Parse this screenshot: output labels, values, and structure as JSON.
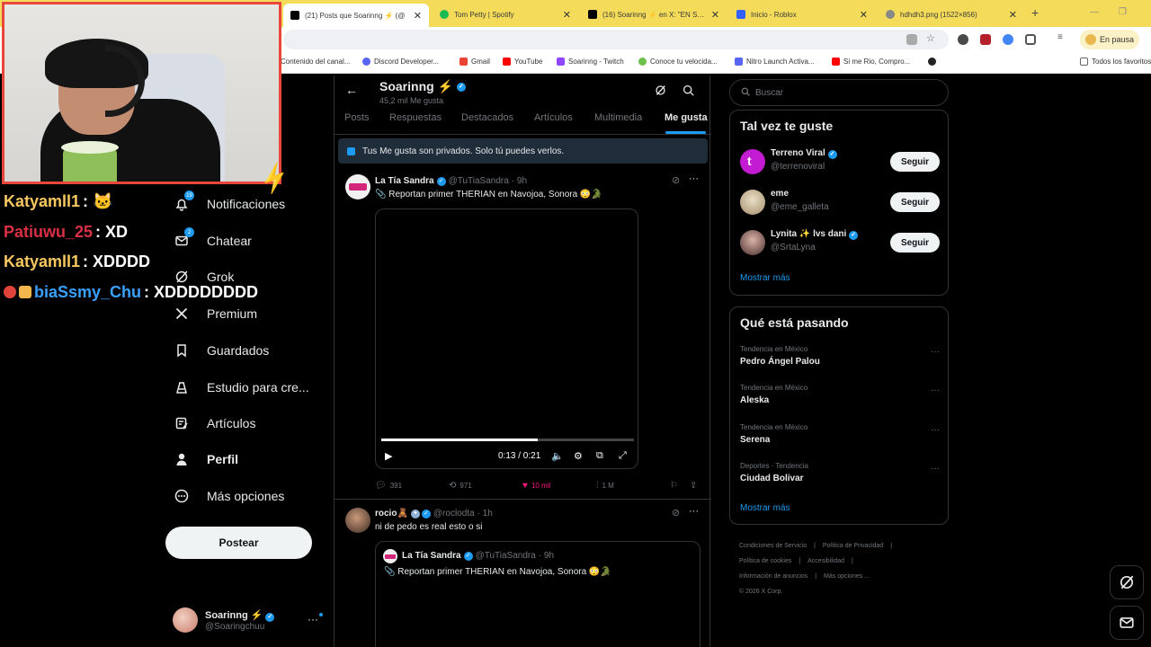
{
  "browser": {
    "tabs": [
      {
        "label": "(21) Posts que Soarinng ⚡ (@",
        "icon": "x-logo",
        "active": true
      },
      {
        "label": "Tom Petty | Spotify",
        "icon": "spotify-logo",
        "active": false
      },
      {
        "label": "(16) Soarinng ⚡ en X: \"EN STR",
        "icon": "x-logo",
        "active": false
      },
      {
        "label": "Inicio - Roblox",
        "icon": "roblox-logo",
        "active": false
      },
      {
        "label": "hdhdh3.png (1522×856)",
        "icon": "image-icon",
        "active": false
      }
    ],
    "paused_label": "En pausa",
    "bookmarks": [
      "Contenido del canal...",
      "Discord Developer...",
      "Gmail",
      "YouTube",
      "Soarinng - Twitch",
      "Conoce tu velocida...",
      "Nitro Launch Activa...",
      "Si me Rio, Compro..."
    ],
    "all_bookmarks": "Todos los favoritos"
  },
  "nav": {
    "items": [
      {
        "label": "Notificaciones",
        "icon": "bell-icon",
        "badge": "19"
      },
      {
        "label": "Chatear",
        "icon": "envelope-icon",
        "badge": "2"
      },
      {
        "label": "Grok",
        "icon": "grok-icon"
      },
      {
        "label": "Premium",
        "icon": "x-icon"
      },
      {
        "label": "Guardados",
        "icon": "bookmark-icon"
      },
      {
        "label": "Estudio para cre...",
        "icon": "creator-icon"
      },
      {
        "label": "Artículos",
        "icon": "article-icon"
      },
      {
        "label": "Perfil",
        "icon": "person-icon"
      },
      {
        "label": "Más opciones",
        "icon": "more-circle-icon"
      }
    ],
    "post_button": "Postear"
  },
  "account": {
    "name": "Soarinng ⚡",
    "handle": "@Soaringchuu"
  },
  "profile": {
    "name": "Soarinng ⚡",
    "likes_count": "45,2 mil Me gusta",
    "tabs": [
      "Posts",
      "Respuestas",
      "Destacados",
      "Artículos",
      "Multimedia",
      "Me gusta"
    ],
    "active_tab": "Me gusta",
    "privacy_notice": "Tus Me gusta son privados. Solo tú puedes verlos."
  },
  "posts": [
    {
      "author": "La Tía Sandra",
      "handle": "@TuTiaSandra",
      "time": "· 9h",
      "text": "📎 Reportan primer THERIAN en Navojoa, Sonora 😳🐊",
      "video": {
        "time": "0:13 / 0:21",
        "progress": 0.62
      },
      "stats": {
        "replies": "391",
        "reposts": "971",
        "likes": "10 mil",
        "views": "1 M"
      }
    },
    {
      "author": "rocio🧸",
      "handle": "@roclodta",
      "time": "· 1h",
      "text": "ni de pedo es real esto o si",
      "quote": {
        "author": "La Tía Sandra",
        "handle": "@TuTiaSandra",
        "time": "· 9h",
        "text": "📎 Reportan primer THERIAN en Navojoa, Sonora 😳🐊"
      }
    }
  ],
  "right": {
    "search_placeholder": "Buscar",
    "who_title": "Tal vez te guste",
    "who": [
      {
        "name": "Terreno Viral",
        "handle": "@terrenoviral",
        "btn": "Seguir",
        "color": "#c21bd1"
      },
      {
        "name": "eme",
        "handle": "@eme_galleta",
        "btn": "Seguir",
        "color": "#c9b28a"
      },
      {
        "name": "Lynita ✨ lvs dani",
        "handle": "@SrtaLyna",
        "btn": "Seguir",
        "color": "#6f4a4a"
      }
    ],
    "show_more": "Mostrar más",
    "trends_title": "Qué está pasando",
    "trends": [
      {
        "context": "Tendencia en México",
        "name": "Pedro Ángel Palou"
      },
      {
        "context": "Tendencia en México",
        "name": "Aleska"
      },
      {
        "context": "Tendencia en México",
        "name": "Serena"
      },
      {
        "context": "Deportes · Tendencia",
        "name": "Ciudad Bolivar"
      }
    ],
    "trends_more": "Mostrar más",
    "footer": [
      "Condiciones de Servicio",
      "Política de Privacidad",
      "Política de cookies",
      "Accesibilidad",
      "Información de anuncios",
      "Más opciones ...",
      "© 2026 X Corp."
    ]
  },
  "stream_chat": [
    {
      "user": "Katyamll1",
      "msg": ": 🐱",
      "user_color": "#f6c85f"
    },
    {
      "user": "Patiuwu_25",
      "msg": ": XD",
      "user_color": "#d93045"
    },
    {
      "user": "Katyamll1",
      "msg": ": XDDDD",
      "user_color": "#f6c85f"
    },
    {
      "user": "biaSsmy_Chu",
      "msg": ": XDDDDDDDD",
      "user_color": "#3aa0ff"
    }
  ]
}
